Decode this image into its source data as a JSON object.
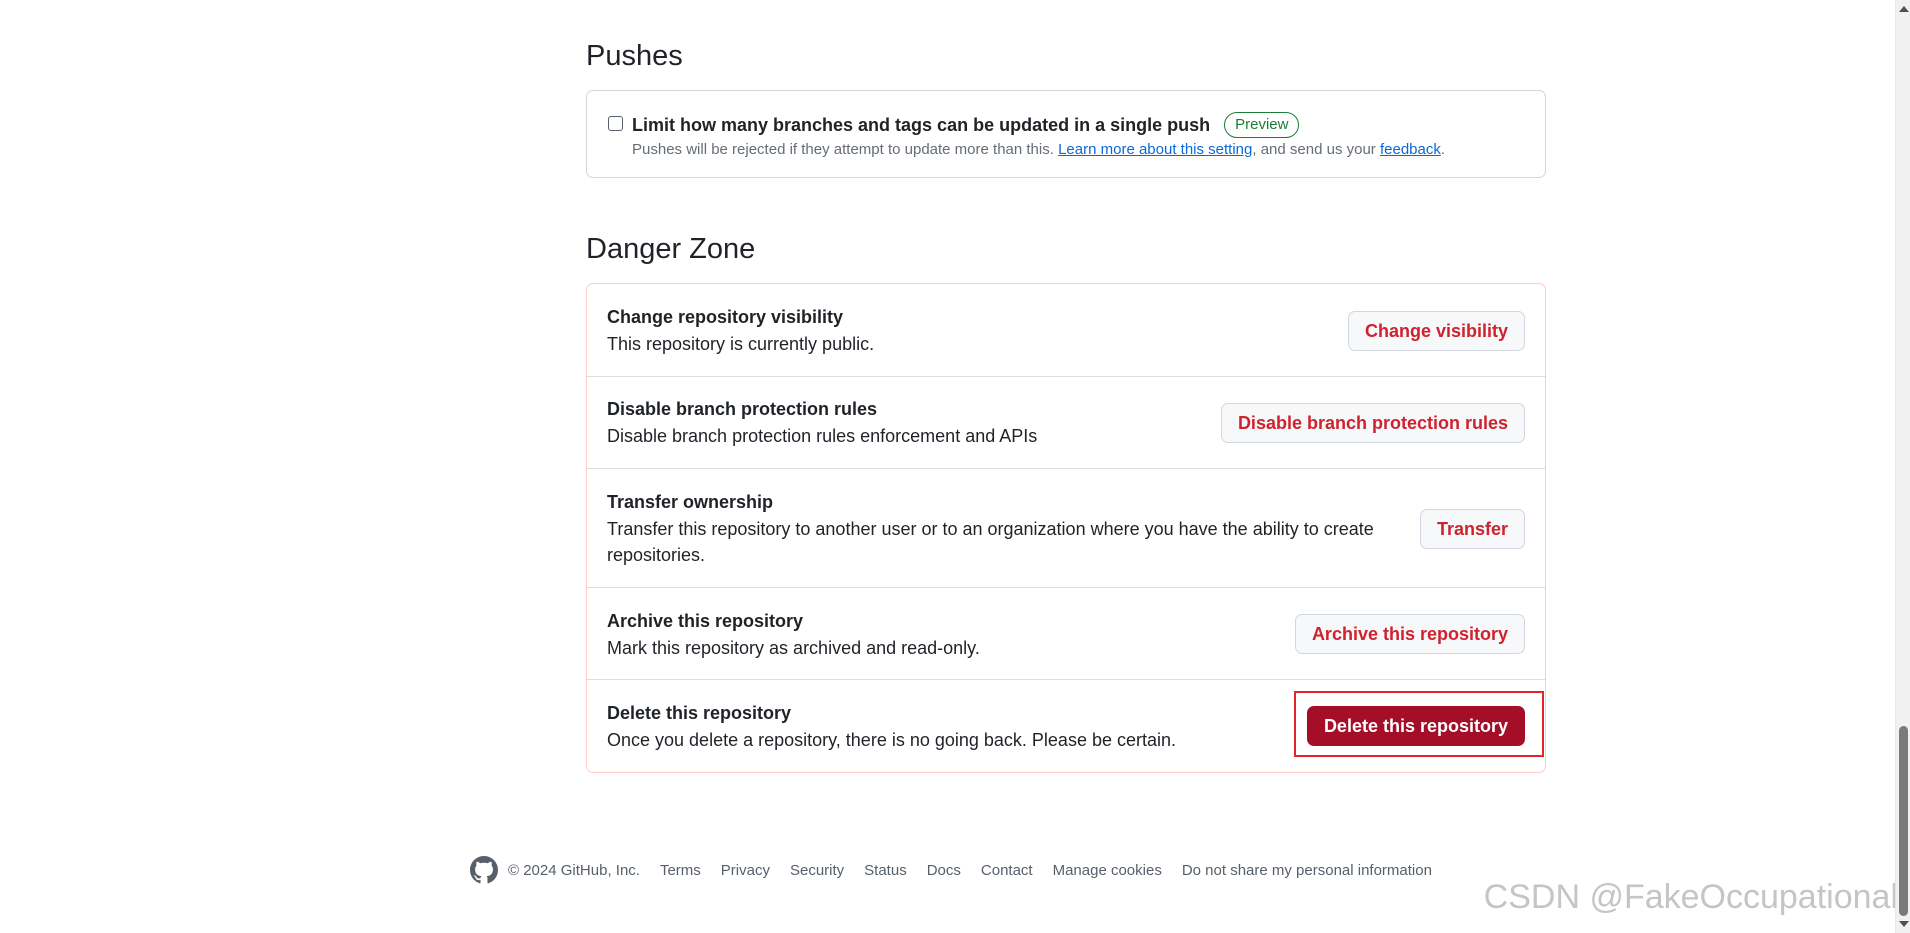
{
  "pushes": {
    "title": "Pushes",
    "checkbox_label": "Limit how many branches and tags can be updated in a single push",
    "badge": "Preview",
    "desc_prefix": "Pushes will be rejected if they attempt to update more than this. ",
    "learn_more_link": "Learn more about this setting",
    "desc_middle": ", and send us your ",
    "feedback_link": "feedback",
    "desc_suffix": "."
  },
  "danger": {
    "title": "Danger Zone",
    "rows": [
      {
        "title": "Change repository visibility",
        "desc": "This repository is currently public.",
        "button": "Change visibility"
      },
      {
        "title": "Disable branch protection rules",
        "desc": "Disable branch protection rules enforcement and APIs",
        "button": "Disable branch protection rules"
      },
      {
        "title": "Transfer ownership",
        "desc": "Transfer this repository to another user or to an organization where you have the ability to create repositories.",
        "button": "Transfer"
      },
      {
        "title": "Archive this repository",
        "desc": "Mark this repository as archived and read-only.",
        "button": "Archive this repository"
      },
      {
        "title": "Delete this repository",
        "desc": "Once you delete a repository, there is no going back. Please be certain.",
        "button": "Delete this repository"
      }
    ]
  },
  "footer": {
    "copyright": "© 2024 GitHub, Inc.",
    "links": [
      "Terms",
      "Privacy",
      "Security",
      "Status",
      "Docs",
      "Contact",
      "Manage cookies",
      "Do not share my personal information"
    ]
  },
  "watermark": "CSDN @FakeOccupational",
  "colors": {
    "danger_text": "#cf222e",
    "danger_solid": "#a40e26",
    "highlight": "#e3242b",
    "preview_green": "#1a7f37",
    "link_blue": "#0969da"
  },
  "icons": {
    "footer_logo": "github-mark-icon"
  }
}
